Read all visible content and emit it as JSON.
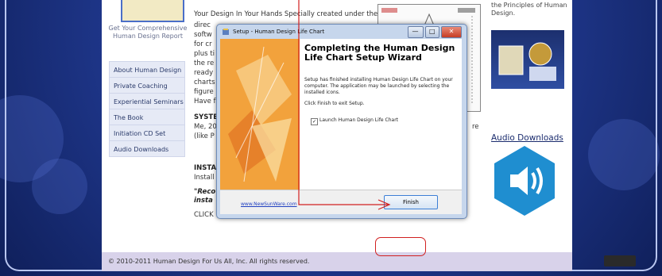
{
  "sidebar": {
    "report_label": "Get Your Comprehensive Human Design Report",
    "nav_items": [
      "About Human Design",
      "Private Coaching",
      "Experiential Seminars",
      "The Book",
      "Initiation CD Set",
      "Audio Downloads"
    ]
  },
  "main": {
    "intro_line": "Your Design In Your Hands Specially created under the",
    "partial_lines": [
      "direc",
      "softw",
      "for cr",
      "plus ti",
      "the re",
      "ready",
      "charts",
      "figure",
      "Have f"
    ],
    "system_label": "SYSTE",
    "system_lines": [
      "Me, 20",
      "(like P"
    ],
    "install_label": "INSTA",
    "install_line": "Install",
    "quote_lines": [
      "\"Reco",
      "insta"
    ],
    "click_line": "CLICK",
    "right_partial": "re"
  },
  "right": {
    "principles_text": "the Principles of Human Design.",
    "audio_downloads": "Audio Downloads"
  },
  "footer": {
    "copyright": "© 2010-2011 Human Design For Us All, Inc. All rights reserved."
  },
  "dialog": {
    "title": "Setup - Human Design Life Chart",
    "heading": "Completing the Human Design Life Chart Setup Wizard",
    "body_text": "Setup has finished installing Human Design Life Chart on your computer. The application may be launched by selecting the installed icons.",
    "click_finish": "Click Finish to exit Setup.",
    "launch_checkbox": "Launch Human Design Life Chart",
    "launch_checked": true,
    "site_link": "www.NewSunWare.com",
    "finish_label": "Finish"
  },
  "colors": {
    "annotation": "#d12020",
    "page_background": "#213a92",
    "footer": "#d8d2ea"
  }
}
